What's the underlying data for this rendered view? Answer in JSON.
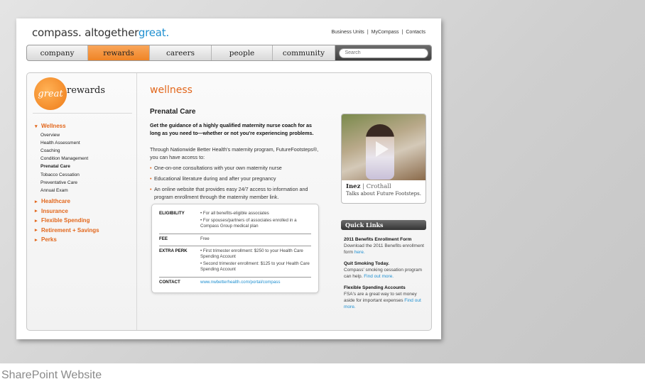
{
  "caption": "SharePoint Website",
  "header": {
    "logo_prefix": "compass. altogether",
    "logo_accent": "great.",
    "utility_links": [
      "Business Units",
      "MyCompass",
      "Contacts"
    ]
  },
  "nav": {
    "tabs": [
      {
        "label": "company",
        "active": false
      },
      {
        "label": "rewards",
        "active": true
      },
      {
        "label": "careers",
        "active": false
      },
      {
        "label": "people",
        "active": false
      },
      {
        "label": "community",
        "active": false
      }
    ],
    "search_placeholder": "Search"
  },
  "sidebar": {
    "badge_text": "great",
    "brand_text": "rewards",
    "categories": [
      {
        "label": "Wellness",
        "expanded": true,
        "items": [
          "Overview",
          "Health Assessment",
          "Coaching",
          "Condition Management",
          "Prenatal Care",
          "Tobacco Cessation",
          "Preventative Care",
          "Annual Exam"
        ],
        "current": "Prenatal Care"
      },
      {
        "label": "Healthcare",
        "expanded": false,
        "items": []
      },
      {
        "label": "Insurance",
        "expanded": false,
        "items": []
      },
      {
        "label": "Flexible Spending",
        "expanded": false,
        "items": []
      },
      {
        "label": "Retirement + Savings",
        "expanded": false,
        "items": []
      },
      {
        "label": "Perks",
        "expanded": false,
        "items": []
      }
    ]
  },
  "main": {
    "section_title": "wellness",
    "heading": "Prenatal Care",
    "intro": "Get the guidance of a highly qualified maternity nurse coach for as long as you need to—whether or not you're experiencing problems.",
    "body": "Through Nationwide Better Health's maternity program, FutureFootsteps®, you can have access to:",
    "bullets": [
      "One-on-one consultations with your own maternity nurse",
      "Educational literature during and after your pregnancy",
      "An online website that provides easy 24/7 access to information and program enrollment through the maternity member link."
    ],
    "info": [
      {
        "label": "ELIGIBILITY",
        "values": [
          "• For all benefits-eligible associates",
          "• For spouses/partners of associates enrolled in a Compass Group medical plan"
        ]
      },
      {
        "label": "FEE",
        "values": [
          "Free"
        ]
      },
      {
        "label": "EXTRA PERK",
        "values": [
          "• First trimester enrollment: $250 to your Health Care Spending Account",
          "• Second trimester enrollment: $125 to your Health Care Spending Account"
        ]
      },
      {
        "label": "CONTACT",
        "values": [
          "www.nwbetterhealth.com/portal/compass"
        ],
        "link": true
      }
    ]
  },
  "video": {
    "name_bold": "Inez",
    "name_rest": "| Crothall",
    "caption": "Talks about Future Footsteps."
  },
  "quick_links": {
    "title": "Quick Links",
    "items": [
      {
        "title": "2011 Benefits Enrollment Form",
        "desc": "Download the 2011 Benefits enrollment form",
        "link": "here."
      },
      {
        "title": "Quit Smoking Today.",
        "desc": "Compass' smoking cessation program can help.",
        "link": "Find out more."
      },
      {
        "title": "Flexible Spending Accounts",
        "desc": "FSA's are a great way to set money aside for important expenses",
        "link": "Find out more."
      }
    ]
  }
}
